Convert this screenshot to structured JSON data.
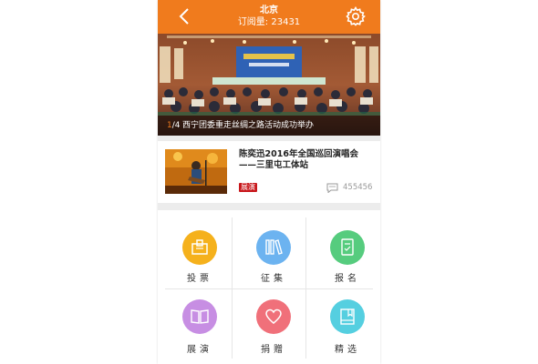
{
  "header": {
    "city": "北京",
    "subscribers": "订阅量: 23431"
  },
  "banner": {
    "slide_current": "1",
    "slide_total": "/4",
    "caption": "西宁团委重走丝绸之路活动成功举办"
  },
  "news": {
    "title": "陈奕迅2016年全国巡回演唱会——三里屯工体站",
    "tag": "展演",
    "comment_count": "455456"
  },
  "categories": [
    {
      "label": "投票",
      "icon": "ballot-box-icon",
      "color": "#f5b11c"
    },
    {
      "label": "征集",
      "icon": "books-icon",
      "color": "#6cb3f0"
    },
    {
      "label": "报名",
      "icon": "form-icon",
      "color": "#56cc7e"
    },
    {
      "label": "展演",
      "icon": "open-book-icon",
      "color": "#c78ee3"
    },
    {
      "label": "捐赠",
      "icon": "heart-icon",
      "color": "#f0707a"
    },
    {
      "label": "精选",
      "icon": "bookmark-book-icon",
      "color": "#55cfe0"
    }
  ],
  "colors": {
    "brand": "#f07b1d",
    "tag": "#c8171b"
  }
}
